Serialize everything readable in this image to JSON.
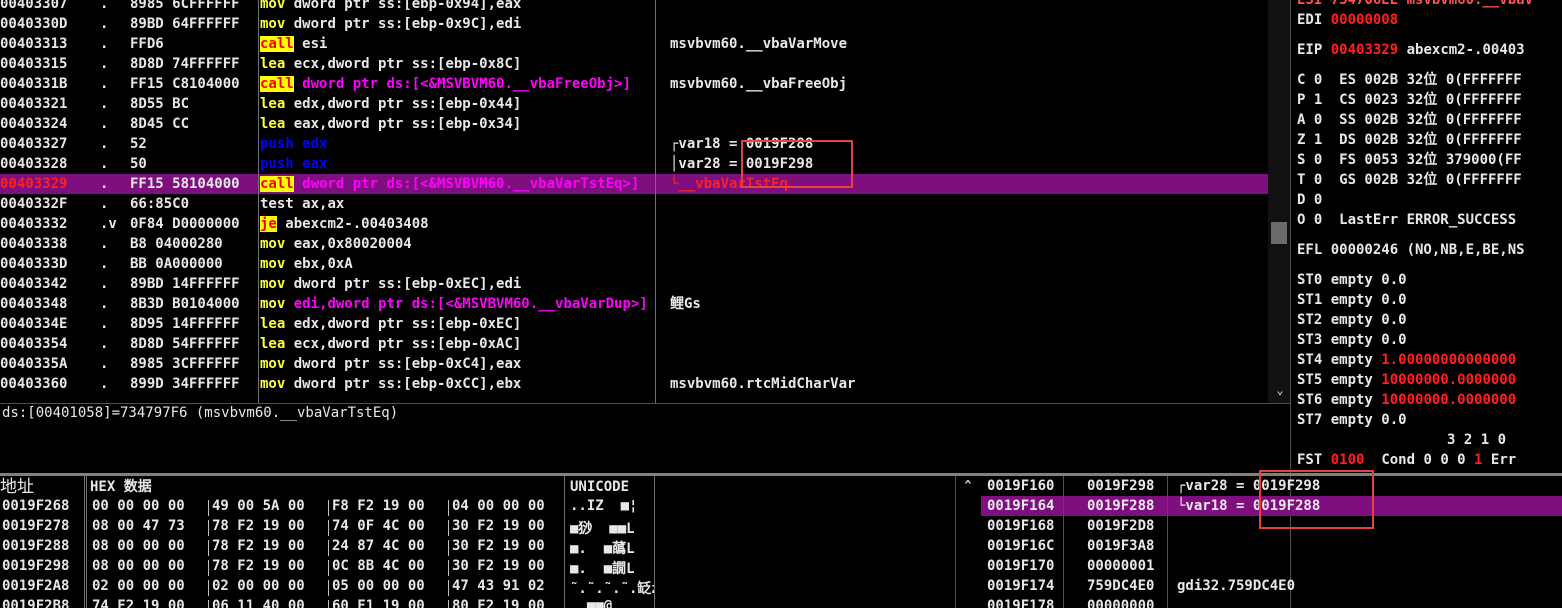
{
  "disasm": {
    "rows": [
      {
        "addr": "00403307",
        "dot": ".",
        "hex": "8985 6CFFFFFF",
        "op": "mov",
        "args": "dword ptr ss:[ebp-0x94],eax",
        "comment": ""
      },
      {
        "addr": "0040330D",
        "dot": ".",
        "hex": "89BD 64FFFFFF",
        "op": "mov",
        "args": "dword ptr ss:[ebp-0x9C],edi",
        "comment": ""
      },
      {
        "addr": "00403313",
        "dot": ".",
        "hex": "FFD6",
        "op": "call",
        "args": "esi",
        "comment": "msvbvm60.__vbaVarMove"
      },
      {
        "addr": "00403315",
        "dot": ".",
        "hex": "8D8D 74FFFFFF",
        "op": "lea",
        "args": "ecx,dword ptr ss:[ebp-0x8C]",
        "comment": ""
      },
      {
        "addr": "0040331B",
        "dot": ".",
        "hex": "FF15 C8104000",
        "op": "call",
        "args": "dword ptr ds:[<&MSVBVM60.__vbaFreeObj>]",
        "comment": "msvbvm60.__vbaFreeObj"
      },
      {
        "addr": "00403321",
        "dot": ".",
        "hex": "8D55 BC",
        "op": "lea",
        "args": "edx,dword ptr ss:[ebp-0x44]",
        "comment": ""
      },
      {
        "addr": "00403324",
        "dot": ".",
        "hex": "8D45 CC",
        "op": "lea",
        "args": "eax,dword ptr ss:[ebp-0x34]",
        "comment": ""
      },
      {
        "addr": "00403327",
        "dot": ".",
        "hex": "52",
        "op": "push",
        "args": "edx",
        "comment": "┌var18 = 0019F288"
      },
      {
        "addr": "00403328",
        "dot": ".",
        "hex": "50",
        "op": "push",
        "args": "eax",
        "comment": "│var28 = 0019F298"
      },
      {
        "addr": "00403329",
        "dot": ".",
        "hex": "FF15 58104000",
        "op": "call",
        "args": "dword ptr ds:[<&MSVBVM60.__vbaVarTstEq>]",
        "comment": "└__vbaVarTstEq"
      },
      {
        "addr": "0040332F",
        "dot": ".",
        "hex": "66:85C0",
        "op": "test",
        "args": "ax,ax",
        "comment": ""
      },
      {
        "addr": "00403332",
        "dot": ".v",
        "hex": "0F84 D0000000",
        "op": "je",
        "args": "abexcm2-.00403408",
        "comment": ""
      },
      {
        "addr": "00403338",
        "dot": ".",
        "hex": "B8 04000280",
        "op": "mov",
        "args": "eax,0x80020004",
        "comment": ""
      },
      {
        "addr": "0040333D",
        "dot": ".",
        "hex": "BB 0A000000",
        "op": "mov",
        "args": "ebx,0xA",
        "comment": ""
      },
      {
        "addr": "00403342",
        "dot": ".",
        "hex": "89BD 14FFFFFF",
        "op": "mov",
        "args": "dword ptr ss:[ebp-0xEC],edi",
        "comment": ""
      },
      {
        "addr": "00403348",
        "dot": ".",
        "hex": "8B3D B0104000",
        "op": "mov",
        "args": "edi,dword ptr ds:[<&MSVBVM60.__vbaVarDup>]",
        "comment": "鲤Gs"
      },
      {
        "addr": "0040334E",
        "dot": ".",
        "hex": "8D95 14FFFFFF",
        "op": "lea",
        "args": "edx,dword ptr ss:[ebp-0xEC]",
        "comment": ""
      },
      {
        "addr": "00403354",
        "dot": ".",
        "hex": "8D8D 54FFFFFF",
        "op": "lea",
        "args": "ecx,dword ptr ss:[ebp-0xAC]",
        "comment": ""
      },
      {
        "addr": "0040335A",
        "dot": ".",
        "hex": "8985 3CFFFFFF",
        "op": "mov",
        "args": "dword ptr ss:[ebp-0xC4],eax",
        "comment": ""
      },
      {
        "addr": "00403360",
        "dot": ".",
        "hex": "899D 34FFFFFF",
        "op": "mov",
        "args": "dword ptr ss:[ebp-0xCC],ebx",
        "comment": "msvbvm60.rtcMidCharVar"
      }
    ],
    "selected_index": 9
  },
  "info_line": "ds:[00401058]=734797F6 (msvbvm60.__vbaVarTstEq)",
  "registers": {
    "esi_line": "ESI 734706EE msvbvm60.__vbaV",
    "edi_label": "EDI",
    "edi_value": "00000008",
    "eip_label": "EIP",
    "eip_value": "00403329",
    "eip_desc": "abexcm2-.00403",
    "segs": [
      "C 0  ES 002B 32位 0(FFFFFFF",
      "P 1  CS 0023 32位 0(FFFFFFF",
      "A 0  SS 002B 32位 0(FFFFFFF",
      "Z 1  DS 002B 32位 0(FFFFFFF",
      "S 0  FS 0053 32位 379000(FF",
      "T 0  GS 002B 32位 0(FFFFFFF",
      "D 0",
      "O 0  LastErr ERROR_SUCCESS"
    ],
    "efl": "EFL 00000246 (NO,NB,E,BE,NS",
    "st": [
      {
        "label": "ST0 empty",
        "value": "0.0",
        "red": false
      },
      {
        "label": "ST1 empty",
        "value": "0.0",
        "red": false
      },
      {
        "label": "ST2 empty",
        "value": "0.0",
        "red": false
      },
      {
        "label": "ST3 empty",
        "value": "0.0",
        "red": false
      },
      {
        "label": "ST4 empty",
        "value": "1.00000000000000",
        "red": true
      },
      {
        "label": "ST5 empty",
        "value": "10000000.0000000",
        "red": true
      },
      {
        "label": "ST6 empty",
        "value": "10000000.0000000",
        "red": true
      },
      {
        "label": "ST7 empty",
        "value": "0.0",
        "red": false
      }
    ],
    "fpu_bits": "3 2 1 0",
    "fst_label": "FST",
    "fst_value": "0100",
    "cond_label": "Cond 0 0 0",
    "cond_last": "1",
    "err_label": "Err"
  },
  "dump": {
    "headers": {
      "addr": "地址",
      "hex": "HEX 数据",
      "unicode": "UNICODE"
    },
    "rows": [
      {
        "addr": "0019F268",
        "hex": [
          "00 00 00 00",
          "49 00 5A 00",
          "F8 F2 19 00",
          "04 00 00 00"
        ],
        "uni": "..IZ  ■¦"
      },
      {
        "addr": "0019F278",
        "hex": [
          "08 00 47 73",
          "78 F2 19 00",
          "74 0F 4C 00",
          "30 F2 19 00"
        ],
        "uni": "■猀  ■■L"
      },
      {
        "addr": "0019F288",
        "hex": [
          "08 00 00 00",
          "78 F2 19 00",
          "24 87 4C 00",
          "30 F2 19 00"
        ],
        "uni": "■.  ■蘤L"
      },
      {
        "addr": "0019F298",
        "hex": [
          "08 00 00 00",
          "78 F2 19 00",
          "0C 8B 4C 00",
          "30 F2 19 00"
        ],
        "uni": "■.  ■譋L"
      },
      {
        "addr": "0019F2A8",
        "hex": [
          "02 00 00 00",
          "02 00 00 00",
          "05 00 00 00",
          "47 43 91 02"
        ],
        "uni": "˜.˜.˜.˜.䍇ʑ"
      },
      {
        "addr": "0019F2B8",
        "hex": [
          "74 F2 19 00",
          "06 11 40 00",
          "60 F1 19 00",
          "80 F2 19 00"
        ],
        "uni": "  ■■@ "
      }
    ]
  },
  "stack": {
    "rows": [
      {
        "addr": "0019F160",
        "val": "0019F298",
        "comment": "┌var28 = 0019F298"
      },
      {
        "addr": "0019F164",
        "val": "0019F288",
        "comment": "└var18 = 0019F288"
      },
      {
        "addr": "0019F168",
        "val": "0019F2D8",
        "comment": ""
      },
      {
        "addr": "0019F16C",
        "val": "0019F3A8",
        "comment": ""
      },
      {
        "addr": "0019F170",
        "val": "00000001",
        "comment": ""
      },
      {
        "addr": "0019F174",
        "val": "759DC4E0",
        "comment": "gdi32.759DC4E0"
      },
      {
        "addr": "0019F178",
        "val": "00000000",
        "comment": ""
      }
    ],
    "selected_index": 1
  }
}
